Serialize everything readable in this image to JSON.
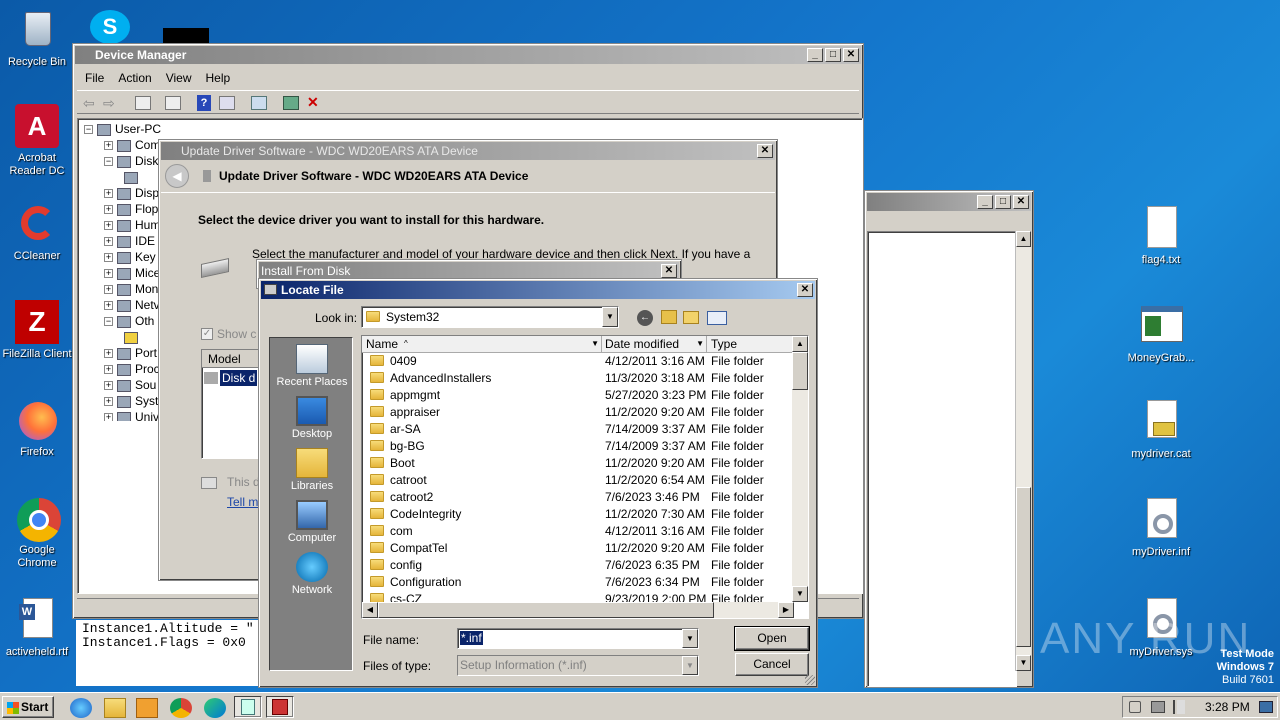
{
  "desktop": {
    "icons": [
      {
        "label": "Recycle Bin"
      },
      {
        "label": "Acrobat Reader DC"
      },
      {
        "label": "CCleaner"
      },
      {
        "label": "FileZilla Client"
      },
      {
        "label": "Firefox"
      },
      {
        "label": "Google Chrome"
      },
      {
        "label": "activeheld.rtf"
      },
      {
        "label": "flag4.txt"
      },
      {
        "label": "MoneyGrab..."
      },
      {
        "label": "mydriver.cat"
      },
      {
        "label": "myDriver.inf"
      },
      {
        "label": "myDriver.sys"
      }
    ],
    "watermark": "ANY RUN",
    "test_mode": {
      "line1": "Test Mode",
      "line2": "Windows 7",
      "line3": "Build 7601"
    }
  },
  "device_manager": {
    "title": "Device Manager",
    "menu": [
      "File",
      "Action",
      "View",
      "Help"
    ],
    "tree_root": "User-PC",
    "tree_items": [
      "Com",
      "Disk",
      "",
      "Disp",
      "Flop",
      "Hum",
      "IDE",
      "Key",
      "Mice",
      "Mon",
      "Netv",
      "Oth",
      "",
      "Port",
      "Proc",
      "Sou",
      "Syst",
      "Univ"
    ]
  },
  "notepad_behind": {
    "lines": [
      "Instance1.Altitude = \"",
      "Instance1.Flags = 0x0"
    ]
  },
  "update_driver": {
    "title": "Update Driver Software - WDC WD20EARS ATA Device",
    "header": "Update Driver Software - WDC WD20EARS ATA Device",
    "heading": "Select the device driver you want to install for this hardware.",
    "instruction": "Select the manufacturer and model of your hardware device and then click Next. If you have a",
    "show_compatible": "Show c",
    "model_header": "Model",
    "model_item": "Disk d",
    "note": "This d",
    "link": "Tell m"
  },
  "install_from_disk": {
    "title": "Install From Disk"
  },
  "locate_file": {
    "title": "Locate File",
    "look_in_label": "Look in:",
    "look_in_value": "System32",
    "places": [
      "Recent Places",
      "Desktop",
      "Libraries",
      "Computer",
      "Network"
    ],
    "columns": {
      "name": "Name",
      "date": "Date modified",
      "type": "Type"
    },
    "files": [
      {
        "name": "0409",
        "date": "4/12/2011 3:16 AM",
        "type": "File folder"
      },
      {
        "name": "AdvancedInstallers",
        "date": "11/3/2020 3:18 AM",
        "type": "File folder"
      },
      {
        "name": "appmgmt",
        "date": "5/27/2020 3:23 PM",
        "type": "File folder"
      },
      {
        "name": "appraiser",
        "date": "11/2/2020 9:20 AM",
        "type": "File folder"
      },
      {
        "name": "ar-SA",
        "date": "7/14/2009 3:37 AM",
        "type": "File folder"
      },
      {
        "name": "bg-BG",
        "date": "7/14/2009 3:37 AM",
        "type": "File folder"
      },
      {
        "name": "Boot",
        "date": "11/2/2020 9:20 AM",
        "type": "File folder"
      },
      {
        "name": "catroot",
        "date": "11/2/2020 6:54 AM",
        "type": "File folder"
      },
      {
        "name": "catroot2",
        "date": "7/6/2023 3:46 PM",
        "type": "File folder"
      },
      {
        "name": "CodeIntegrity",
        "date": "11/2/2020 7:30 AM",
        "type": "File folder"
      },
      {
        "name": "com",
        "date": "4/12/2011 3:16 AM",
        "type": "File folder"
      },
      {
        "name": "CompatTel",
        "date": "11/2/2020 9:20 AM",
        "type": "File folder"
      },
      {
        "name": "config",
        "date": "7/6/2023 6:35 PM",
        "type": "File folder"
      },
      {
        "name": "Configuration",
        "date": "7/6/2023 6:34 PM",
        "type": "File folder"
      },
      {
        "name": "cs-CZ",
        "date": "9/23/2019 2:00 PM",
        "type": "File folder"
      }
    ],
    "filename_label": "File name:",
    "filename_value": "*.inf",
    "filetype_label": "Files of type:",
    "filetype_value": "Setup Information (*.inf)",
    "open_label": "Open",
    "cancel_label": "Cancel"
  },
  "taskbar": {
    "start_label": "Start",
    "clock": "3:28 PM"
  },
  "colors": {
    "title_active": "#0a246a",
    "title_gradient_end": "#a6caf0",
    "selection": "#0a246a"
  }
}
